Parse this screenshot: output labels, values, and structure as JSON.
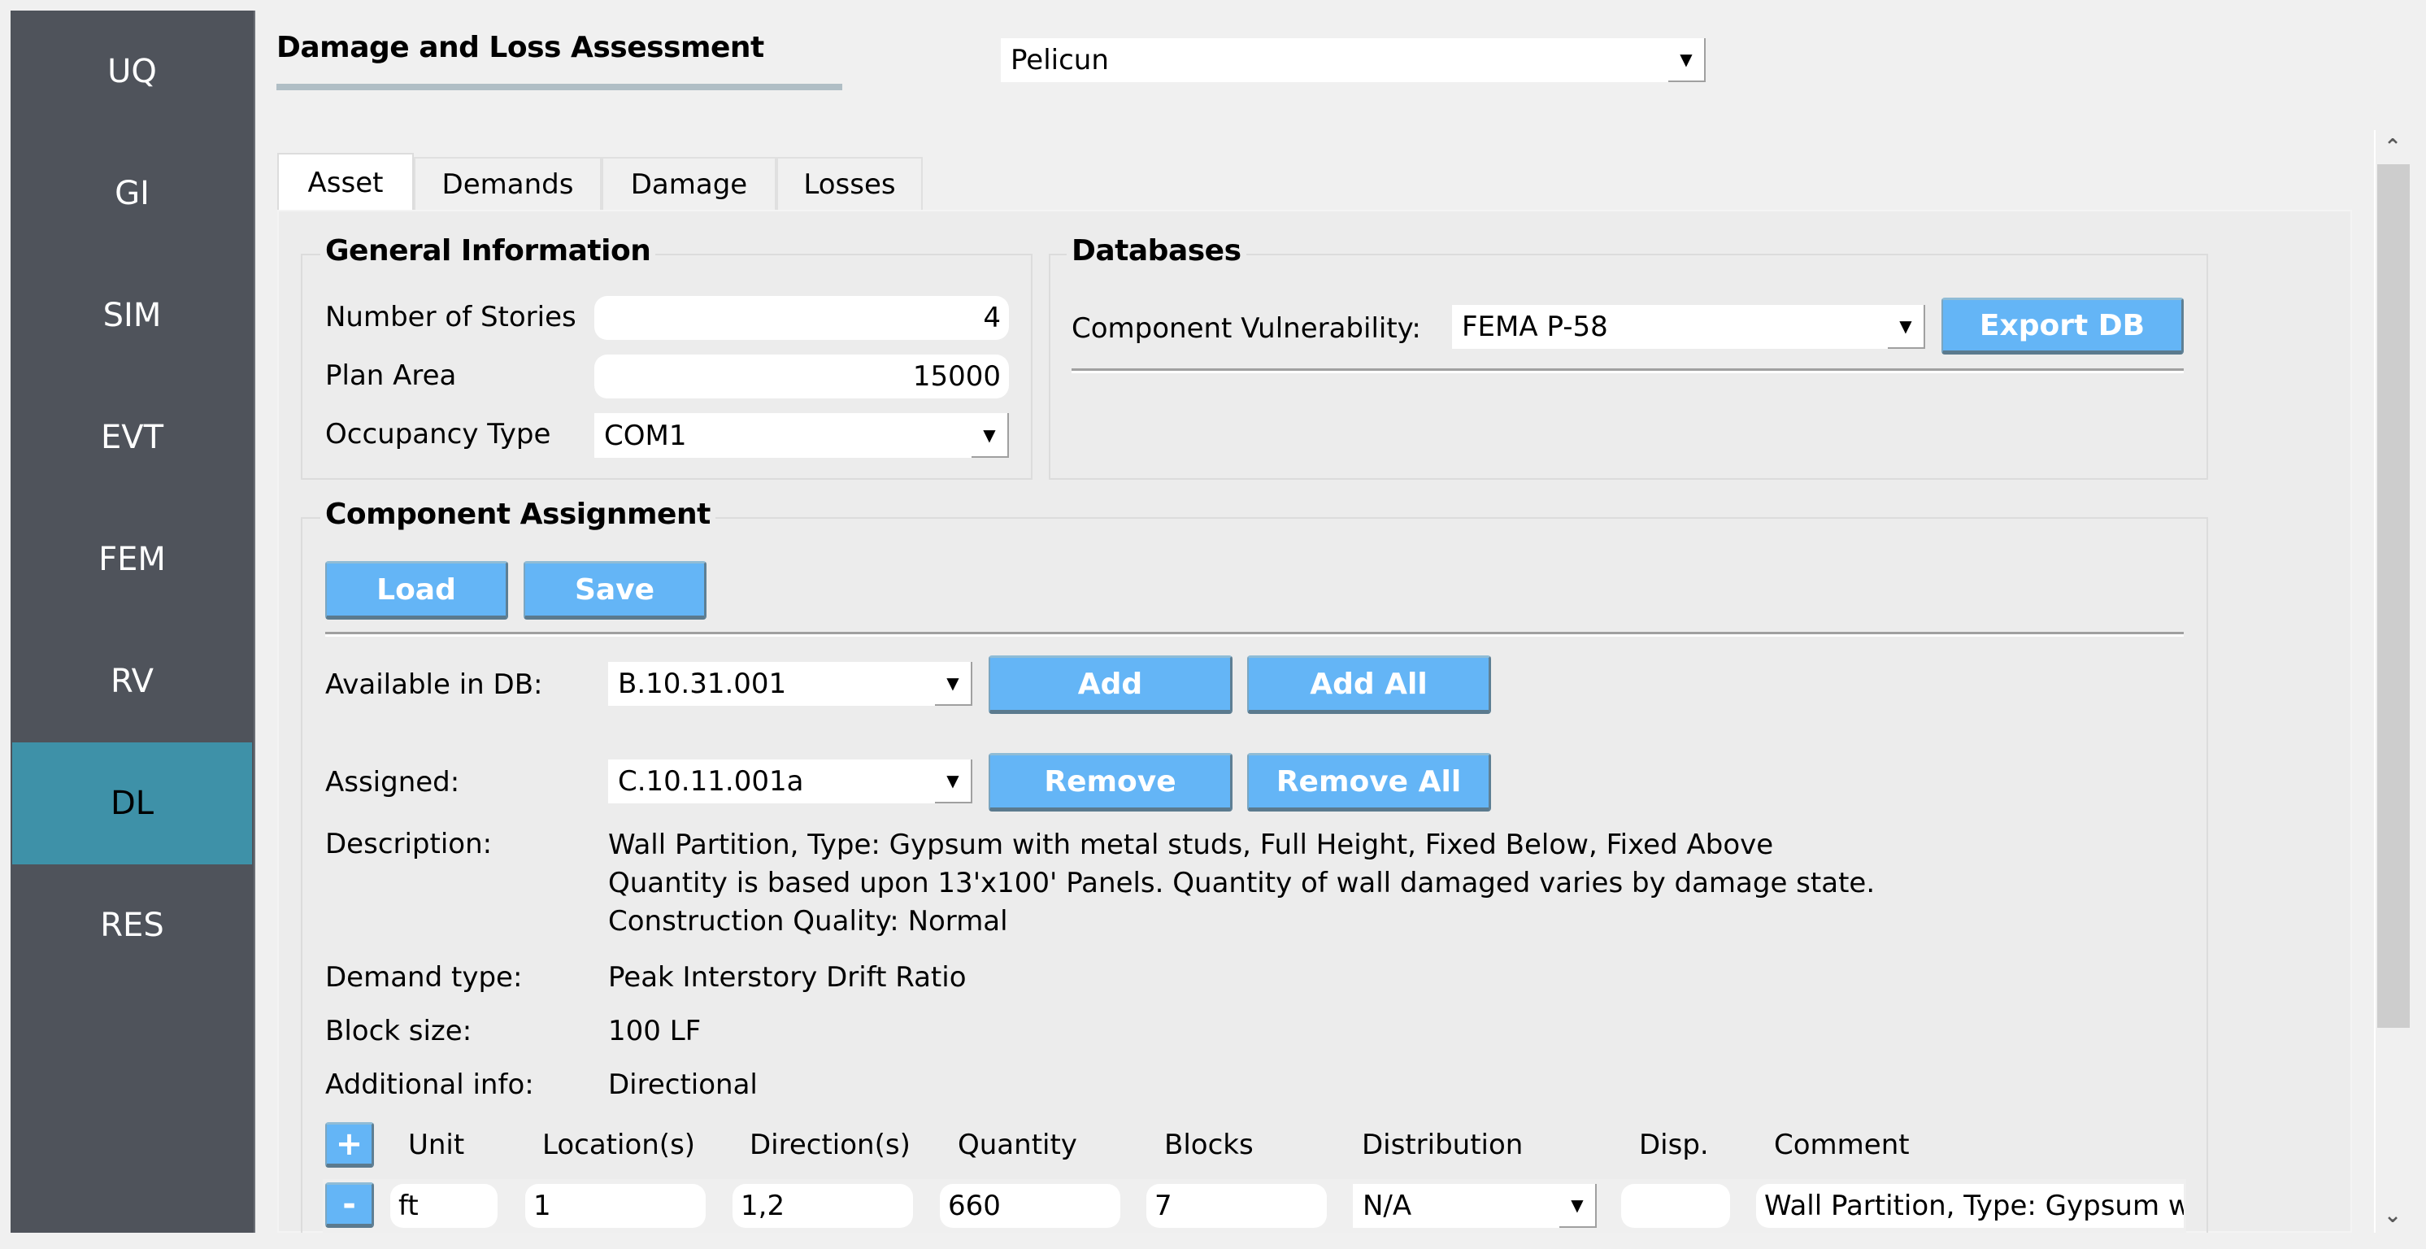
{
  "sidebar": {
    "items": [
      {
        "label": "UQ",
        "active": false
      },
      {
        "label": "GI",
        "active": false
      },
      {
        "label": "SIM",
        "active": false
      },
      {
        "label": "EVT",
        "active": false
      },
      {
        "label": "FEM",
        "active": false
      },
      {
        "label": "RV",
        "active": false
      },
      {
        "label": "DL",
        "active": true
      },
      {
        "label": "RES",
        "active": false
      }
    ],
    "active_color": "#3e91a8",
    "bg_color": "#4f535b"
  },
  "header": {
    "title": "Damage and Loss Assessment",
    "method_select": {
      "value": "Pelicun",
      "arrow": "▼"
    }
  },
  "tabs": [
    {
      "label": "Asset",
      "active": true
    },
    {
      "label": "Demands",
      "active": false
    },
    {
      "label": "Damage",
      "active": false
    },
    {
      "label": "Losses",
      "active": false
    }
  ],
  "general_information": {
    "title": "General Information",
    "number_of_stories": {
      "label": "Number of Stories",
      "value": "4"
    },
    "plan_area": {
      "label": "Plan Area",
      "value": "15000"
    },
    "occupancy_type": {
      "label": "Occupancy Type",
      "value": "COM1",
      "arrow": "▼"
    }
  },
  "databases": {
    "title": "Databases",
    "component_vulnerability": {
      "label": "Component Vulnerability:",
      "value": "FEMA P-58",
      "arrow": "▼"
    },
    "export_button": "Export DB"
  },
  "component_assignment": {
    "title": "Component Assignment",
    "load_button": "Load",
    "save_button": "Save",
    "available": {
      "label": "Available in DB:",
      "value": "B.10.31.001",
      "arrow": "▼"
    },
    "add_button": "Add",
    "add_all_button": "Add All",
    "assigned": {
      "label": "Assigned:",
      "value": "C.10.11.001a",
      "arrow": "▼"
    },
    "remove_button": "Remove",
    "remove_all_button": "Remove All",
    "description": {
      "label": "Description:",
      "lines": [
        "Wall Partition, Type: Gypsum with metal studs, Full Height, Fixed Below, Fixed Above",
        "Quantity is based upon 13'x100' Panels.  Quantity of wall damaged varies by damage state.",
        "Construction Quality: Normal"
      ]
    },
    "demand_type": {
      "label": "Demand type:",
      "value": "Peak Interstory Drift Ratio"
    },
    "block_size": {
      "label": "Block size:",
      "value": "100 LF"
    },
    "additional_info": {
      "label": "Additional info:",
      "value": "Directional"
    },
    "table": {
      "add_row_button": "+",
      "remove_row_button": "-",
      "columns": [
        "Unit",
        "Location(s)",
        "Direction(s)",
        "Quantity",
        "Blocks",
        "Distribution",
        "Disp.",
        "Comment"
      ],
      "rows": [
        {
          "unit": "ft",
          "locations": "1",
          "directions": "1,2",
          "quantity": "660",
          "blocks": "7",
          "distribution": "N/A",
          "distribution_arrow": "▼",
          "disp": "",
          "comment": "Wall Partition, Type: Gypsum with metal studs, Full Height, Fixed Below, Fixed Above"
        }
      ]
    }
  },
  "scrollbar": {
    "up_icon": "⌃",
    "down_icon": "⌄"
  },
  "colors": {
    "button": "#64b5f6",
    "background": "#f0f0f0",
    "panel": "#ececec",
    "title_underline": "#b0bec5"
  }
}
